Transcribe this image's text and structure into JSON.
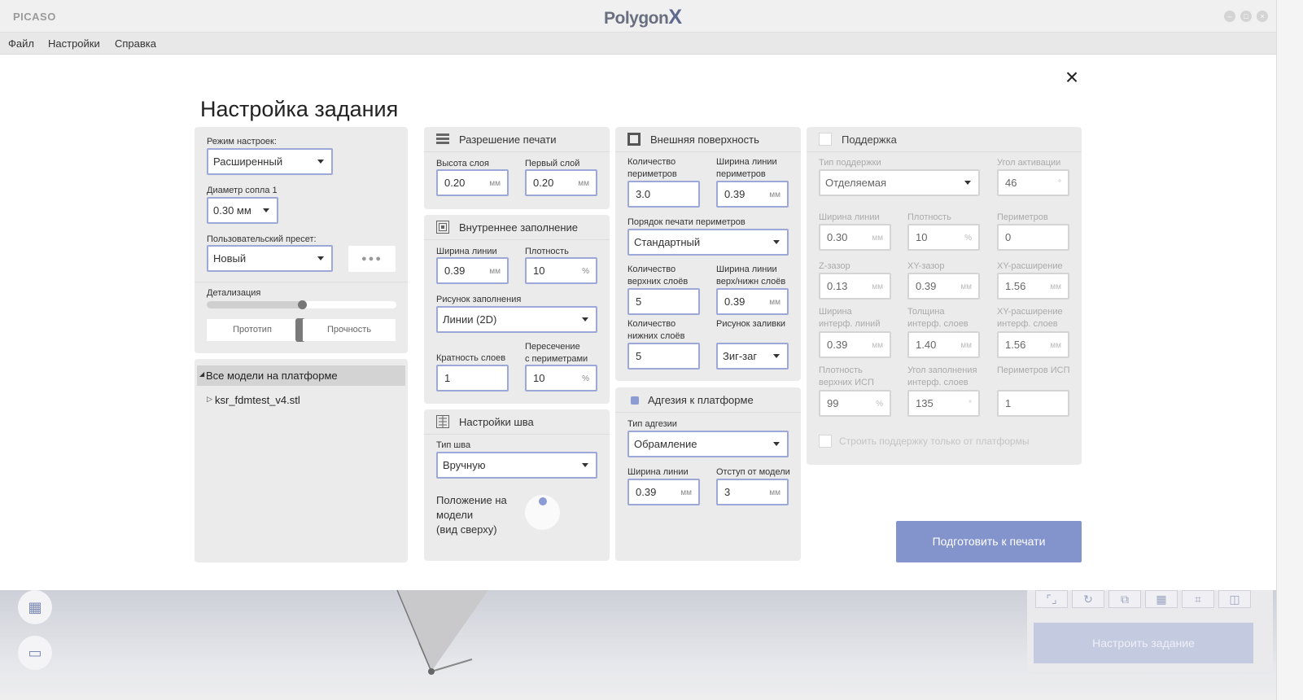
{
  "app": {
    "brand": "PICASO",
    "logo_text": "Polygon",
    "logo_mark": "X"
  },
  "window": {
    "min": "–",
    "max": "□",
    "close": "×"
  },
  "menu": {
    "file": "Файл",
    "settings": "Настройки",
    "help": "Справка"
  },
  "dialog": {
    "title": "Настройка задания",
    "close": "×",
    "prepare_button": "Подготовить к печати"
  },
  "left": {
    "mode_label": "Режим настроек:",
    "mode_value": "Расширенный",
    "nozzle_label": "Диаметр сопла 1",
    "nozzle_value": "0.30 мм",
    "preset_label": "Пользовательский пресет:",
    "preset_value": "Новый",
    "preset_more": "●●●",
    "detail_label": "Детализация",
    "detail_level": 0.5,
    "prototype": "Прототип",
    "strength": "Прочность",
    "tree_root": "Все модели на платформе",
    "tree_item": "ksr_fdmtest_v4.stl"
  },
  "resolution": {
    "title": "Разрешение печати",
    "layer_height_label": "Высота слоя",
    "layer_height": "0.20",
    "layer_height_unit": "мм",
    "first_layer_label": "Первый слой",
    "first_layer": "0.20",
    "first_layer_unit": "мм"
  },
  "infill": {
    "title": "Внутреннее заполнение",
    "line_width_label": "Ширина линии",
    "line_width": "0.39",
    "line_width_unit": "мм",
    "density_label": "Плотность",
    "density": "10",
    "density_unit": "%",
    "pattern_label": "Рисунок заполнения",
    "pattern": "Линии (2D)",
    "multiplicity_label": "Кратность слоев",
    "multiplicity": "1",
    "overlap_label_1": "Пересечение",
    "overlap_label_2": "с периметрами",
    "overlap": "10",
    "overlap_unit": "%"
  },
  "seam": {
    "title": "Настройки шва",
    "type_label": "Тип шва",
    "type": "Вручную",
    "position_l1": "Положение на",
    "position_l2": "модели",
    "position_l3": "(вид сверху)"
  },
  "outer": {
    "title": "Внешняя поверхность",
    "perimeters_l1": "Количество",
    "perimeters_l2": "периметров",
    "perimeters": "3.0",
    "perim_width_l1": "Ширина линии",
    "perim_width_l2": "периметров",
    "perim_width": "0.39",
    "perim_width_unit": "мм",
    "order_label": "Порядок печати периметров",
    "order": "Стандартный",
    "top_l1": "Количество",
    "top_l2": "верхних слоёв",
    "top": "5",
    "tb_width_l1": "Ширина линии",
    "tb_width_l2": "верх/нижн слоёв",
    "tb_width": "0.39",
    "tb_width_unit": "мм",
    "bottom_l1": "Количество",
    "bottom_l2": "нижних слоёв",
    "bottom": "5",
    "fill_pattern_label": "Рисунок заливки",
    "fill_pattern": "Зиг-заг"
  },
  "adhesion": {
    "title": "Адгезия к платформе",
    "type_label": "Тип адгезии",
    "type": "Обрамление",
    "line_width_label": "Ширина линии",
    "line_width": "0.39",
    "line_width_unit": "мм",
    "offset_label": "Отступ от модели",
    "offset": "3",
    "offset_unit": "мм"
  },
  "support": {
    "title": "Поддержка",
    "type_label": "Тип поддержки",
    "type": "Отделяемая",
    "angle_label": "Угол активации",
    "angle": "46",
    "angle_unit": "°",
    "line_width_label": "Ширина линии",
    "line_width": "0.30",
    "line_width_unit": "мм",
    "density_label": "Плотность",
    "density": "10",
    "density_unit": "%",
    "perimeters_label": "Периметров",
    "perimeters": "0",
    "z_gap_label": "Z-зазор",
    "z_gap": "0.13",
    "z_gap_unit": "мм",
    "xy_gap_label": "XY-зазор",
    "xy_gap": "0.39",
    "xy_gap_unit": "мм",
    "xy_exp_label": "XY-расширение",
    "xy_exp": "1.56",
    "xy_exp_unit": "мм",
    "if_width_l1": "Ширина",
    "if_width_l2": "интерф. линий",
    "if_width": "0.39",
    "if_width_unit": "мм",
    "if_thick_l1": "Толщина",
    "if_thick_l2": "интерф. слоев",
    "if_thick": "1.40",
    "if_thick_unit": "мм",
    "if_xy_l1": "XY-расширение",
    "if_xy_l2": "интерф. слоев",
    "if_xy": "1.56",
    "if_xy_unit": "мм",
    "top_density_l1": "Плотность",
    "top_density_l2": "верхних ИСП",
    "top_density": "99",
    "top_density_unit": "%",
    "fill_angle_l1": "Угол заполнения",
    "fill_angle_l2": "интерф. слоев",
    "fill_angle": "135",
    "fill_angle_unit": "°",
    "isp_perims_label": "Периметров ИСП",
    "isp_perims": "1",
    "platform_only": "Строить поддержку только от платформы"
  },
  "viewport": {
    "configure_button": "Настроить задание"
  },
  "colors": {
    "accent": "#8393cc",
    "field_border": "#9ba8d8",
    "panel_bg": "#ebebeb"
  }
}
